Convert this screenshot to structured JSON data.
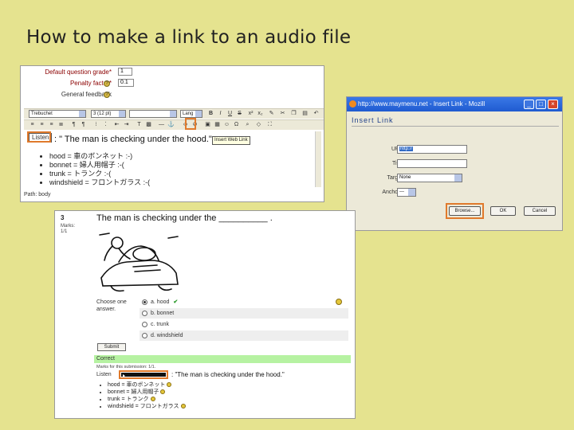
{
  "slide": {
    "title": "How to make a link to an audio file"
  },
  "editor": {
    "fields": [
      {
        "label": "Default question grade*",
        "value": "1"
      },
      {
        "label": "Penalty factor*",
        "value": "0.1"
      },
      {
        "label": "General feedback",
        "value": ""
      }
    ],
    "toolbar": {
      "font": "Trebuchet",
      "size": "3 (12 pt)",
      "style": "",
      "lang": "Lang",
      "bold": "B",
      "italic": "I",
      "underline": "U",
      "strike": "S"
    },
    "link_text": "Listen",
    "sentence": ": \" The man is checking under the hood.\"",
    "tooltip": "Insert Web Link",
    "bullets": [
      "hood = 車のボンネット :-)",
      "bonnet = 婦人用帽子 :-(",
      "trunk = トランク :-(",
      "windshield = フロントガラス :-("
    ],
    "path": "Path: body"
  },
  "dialog": {
    "window_title": "http://www.maymenu.net - Insert Link - Mozill",
    "heading": "Insert Link",
    "url_label": "URL",
    "url_value": "http://",
    "title_label": "Title",
    "title_value": "",
    "target_label": "Target",
    "target_value": "None",
    "anchors_label": "Anchors",
    "anchors_value": "---",
    "browse_label": "Browse...",
    "ok_label": "OK",
    "cancel_label": "Cancel",
    "win_min": "_",
    "win_max": "□",
    "win_close": "×"
  },
  "quiz": {
    "number": "3",
    "marks": "Marks:\n1/1",
    "question": "The man is checking under the __________ .",
    "choose": "Choose one answer.",
    "options": [
      {
        "letter": "a.",
        "text": "hood",
        "selected": true,
        "correct": true
      },
      {
        "letter": "b.",
        "text": "bonnet",
        "selected": false,
        "correct": false
      },
      {
        "letter": "c.",
        "text": "trunk",
        "selected": false,
        "correct": false
      },
      {
        "letter": "d.",
        "text": "windshield",
        "selected": false,
        "correct": false
      }
    ],
    "check_mark": "✔",
    "submit": "Submit",
    "result": "Correct",
    "marks_sub": "Marks for this submission: 1/1.",
    "listen": "Listen",
    "listen_quote": ": \"The man is checking under the hood.\"",
    "feedback": [
      "hood = 車のボンネット",
      "bonnet = 婦人用帽子",
      "trunk = トランク",
      "windshield = フロントガラス"
    ]
  },
  "colors": {
    "background": "#e5e38f",
    "highlight": "#e07a2c",
    "correct": "#b6f2a2",
    "titlebar": "#1f5bd0"
  }
}
